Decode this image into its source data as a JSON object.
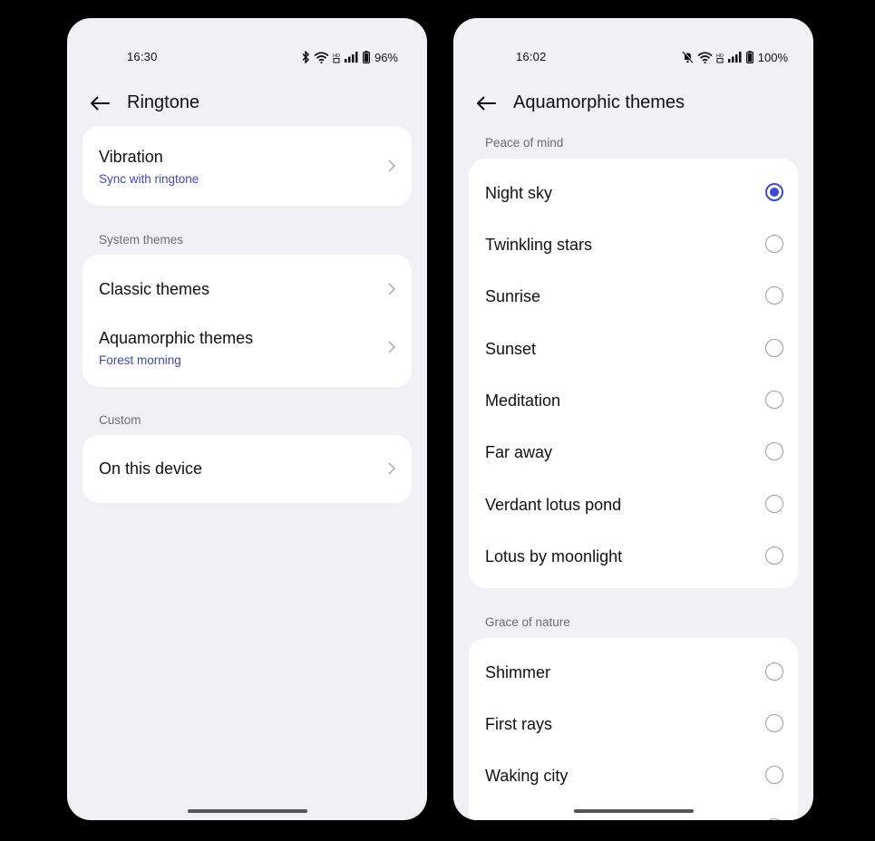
{
  "left": {
    "status": {
      "time": "16:30",
      "battery": "96%"
    },
    "title": "Ringtone",
    "vibration": {
      "title": "Vibration",
      "subtitle": "Sync with ringtone"
    },
    "system_themes": {
      "label": "System themes",
      "items": [
        {
          "title": "Classic themes"
        },
        {
          "title": "Aquamorphic themes",
          "subtitle": "Forest morning"
        }
      ]
    },
    "custom": {
      "label": "Custom",
      "items": [
        {
          "title": "On this device"
        }
      ]
    }
  },
  "right": {
    "status": {
      "time": "16:02",
      "battery": "100%"
    },
    "title": "Aquamorphic themes",
    "groups": [
      {
        "label": "Peace of mind",
        "items": [
          {
            "title": "Night sky",
            "selected": true
          },
          {
            "title": "Twinkling stars",
            "selected": false
          },
          {
            "title": "Sunrise",
            "selected": false
          },
          {
            "title": "Sunset",
            "selected": false
          },
          {
            "title": "Meditation",
            "selected": false
          },
          {
            "title": "Far away",
            "selected": false
          },
          {
            "title": "Verdant lotus pond",
            "selected": false
          },
          {
            "title": "Lotus by moonlight",
            "selected": false
          }
        ]
      },
      {
        "label": "Grace of nature",
        "items": [
          {
            "title": "Shimmer",
            "selected": false
          },
          {
            "title": "First rays",
            "selected": false
          },
          {
            "title": "Waking city",
            "selected": false
          }
        ]
      }
    ]
  },
  "colors": {
    "accent": "#3d4ad1",
    "subtitle": "#3d4ba8",
    "background": "#f0f0f5"
  }
}
